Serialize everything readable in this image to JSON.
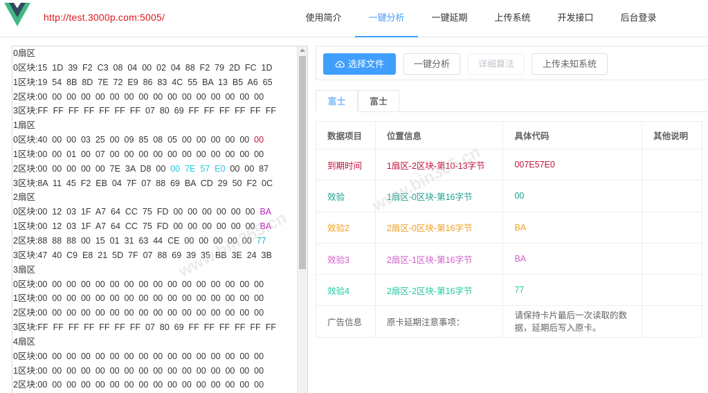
{
  "header": {
    "url": "http://test.3000p.com:5005/",
    "nav": [
      "使用简介",
      "一键分析",
      "一键延期",
      "上传系统",
      "开发接口",
      "后台登录"
    ],
    "active_nav": 1
  },
  "hex": {
    "lines": [
      {
        "text": "0扇区"
      },
      {
        "text": "0区块:15  1D  39  F2  C3  08  04  00  02  04  88  F2  79  2D  FC  1D"
      },
      {
        "text": "1区块:19  54  8B  8D  7E  72  E9  86  83  4C  55  BA  13  B5  A6  65"
      },
      {
        "text": "2区块:00  00  00  00  00  00  00  00  00  00  00  00  00  00  00  00"
      },
      {
        "text": "3区块:FF  FF  FF  FF  FF  FF  FF  07  80  69  FF  FF  FF  FF  FF  FF"
      },
      {
        "text": "1扇区"
      },
      {
        "text": "0区块:40  00  00  03  25  00  09  85  08  05  00  00  00  00  00  ",
        "hl": "00",
        "hl_class": "c-red"
      },
      {
        "text": "1区块:00  00  01  00  07  00  00  00  00  00  00  00  00  00  00  00"
      },
      {
        "pre": "2区块:00  00  00  00  00  7E  3A  D8  00  ",
        "hl": "00  7E  57  E0",
        "hl_class": "c-cyan",
        "post": "  00  00  87"
      },
      {
        "text": "3区块:8A  11  45  F2  EB  04  7F  07  88  69  BA  CD  29  50  F2  0C"
      },
      {
        "text": "2扇区"
      },
      {
        "text": "0区块:00  12  03  1F  A7  64  CC  75  FD  00  00  00  00  00  00  ",
        "hl": "BA",
        "hl_class": "c-purple"
      },
      {
        "text": "1区块:00  12  03  1F  A7  64  CC  75  FD  00  00  00  00  00  00  ",
        "hl": "BA",
        "hl_class": "c-purple"
      },
      {
        "text": "2区块:88  88  88  00  15  01  31  63  44  CE  00  00  00  00  00  ",
        "hl": "77",
        "hl_class": "c-teal"
      },
      {
        "text": "3区块:47  40  C9  E8  21  5D  7F  07  88  69  39  35  BB  3E  24  3B"
      },
      {
        "text": "3扇区"
      },
      {
        "text": "0区块:00  00  00  00  00  00  00  00  00  00  00  00  00  00  00  00"
      },
      {
        "text": "1区块:00  00  00  00  00  00  00  00  00  00  00  00  00  00  00  00"
      },
      {
        "text": "2区块:00  00  00  00  00  00  00  00  00  00  00  00  00  00  00  00"
      },
      {
        "text": "3区块:FF  FF  FF  FF  FF  FF  FF  07  80  69  FF  FF  FF  FF  FF  FF"
      },
      {
        "text": "4扇区"
      },
      {
        "text": "0区块:00  00  00  00  00  00  00  00  00  00  00  00  00  00  00  00"
      },
      {
        "text": "1区块:00  00  00  00  00  00  00  00  00  00  00  00  00  00  00  00"
      },
      {
        "text": "2区块:00  00  00  00  00  00  00  00  00  00  00  00  00  00  00  00"
      }
    ]
  },
  "toolbar": {
    "select_file": "选择文件",
    "analyze": "一键分析",
    "detail_algo": "详细算法",
    "upload_unknown": "上传未知系统"
  },
  "tabs": [
    "富士",
    "富士"
  ],
  "table": {
    "headers": [
      "数据项目",
      "位置信息",
      "具体代码",
      "其他说明"
    ],
    "rows": [
      {
        "item": "到期时间",
        "pos": "1扇区-2区块-第10-13字节",
        "code": "007E57E0",
        "note": "",
        "color": "#c0103b"
      },
      {
        "item": "效验",
        "pos": "1扇区-0区块-第16字节",
        "code": "00",
        "note": "",
        "color": "#1a9e8f"
      },
      {
        "item": "效验2",
        "pos": "2扇区-0区块-第16字节",
        "code": "BA",
        "note": "",
        "color": "#f0a020"
      },
      {
        "item": "效验3",
        "pos": "2扇区-1区块-第16字节",
        "code": "BA",
        "note": "",
        "color": "#d060c8"
      },
      {
        "item": "效验4",
        "pos": "2扇区-2区块-第16字节",
        "code": "77",
        "note": "",
        "color": "#20c8a0"
      },
      {
        "item": "广告信息",
        "pos": "原卡延期注意事项：",
        "code": "请保持卡片最后一次读取的数据，延期后写入原卡。",
        "note": "",
        "color": "#606266"
      }
    ]
  },
  "watermarks": [
    "www.bin365.cn",
    "www.bin365.cn"
  ]
}
